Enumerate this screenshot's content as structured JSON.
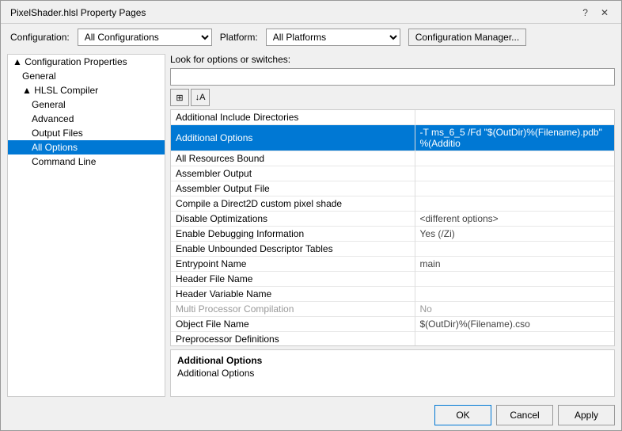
{
  "titleBar": {
    "title": "PixelShader.hlsl Property Pages",
    "helpBtn": "?",
    "closeBtn": "✕"
  },
  "config": {
    "configLabel": "Configuration:",
    "configValue": "All Configurations",
    "platformLabel": "Platform:",
    "platformValue": "All Platforms",
    "managerLabel": "Configuration Manager..."
  },
  "rightPanel": {
    "searchLabel": "Look for options or switches:",
    "searchPlaceholder": "",
    "toolbarBtn1": "≡",
    "toolbarBtn2": "↓"
  },
  "tableRows": [
    {
      "name": "Additional Include Directories",
      "value": ""
    },
    {
      "name": "Additional Options",
      "value": "-T ms_6_5 /Fd \"$(OutDir)%(Filename).pdb\" %(Additio",
      "selected": true
    },
    {
      "name": "All Resources Bound",
      "value": ""
    },
    {
      "name": "Assembler Output",
      "value": ""
    },
    {
      "name": "Assembler Output File",
      "value": ""
    },
    {
      "name": "Compile a Direct2D custom pixel shade",
      "value": ""
    },
    {
      "name": "Disable Optimizations",
      "value": "<different options>"
    },
    {
      "name": "Enable Debugging Information",
      "value": "Yes (/Zi)"
    },
    {
      "name": "Enable Unbounded Descriptor Tables",
      "value": ""
    },
    {
      "name": "Entrypoint Name",
      "value": "main"
    },
    {
      "name": "Header File Name",
      "value": ""
    },
    {
      "name": "Header Variable Name",
      "value": ""
    },
    {
      "name": "Multi Processor Compilation",
      "value": "No",
      "disabled": true
    },
    {
      "name": "Object File Name",
      "value": "$(OutDir)%(Filename).cso"
    },
    {
      "name": "Preprocessor Definitions",
      "value": ""
    }
  ],
  "description": {
    "title": "Additional Options",
    "text": "Additional Options"
  },
  "buttons": {
    "ok": "OK",
    "cancel": "Cancel",
    "apply": "Apply"
  },
  "sidebar": {
    "items": [
      {
        "label": "Configuration Properties",
        "level": 0,
        "arrow": "▲",
        "id": "config-props"
      },
      {
        "label": "General",
        "level": 1,
        "arrow": "",
        "id": "general"
      },
      {
        "label": "HLSL Compiler",
        "level": 1,
        "arrow": "▲",
        "id": "hlsl-compiler"
      },
      {
        "label": "General",
        "level": 2,
        "arrow": "",
        "id": "hlsl-general"
      },
      {
        "label": "Advanced",
        "level": 2,
        "arrow": "",
        "id": "advanced"
      },
      {
        "label": "Output Files",
        "level": 2,
        "arrow": "",
        "id": "output-files"
      },
      {
        "label": "All Options",
        "level": 2,
        "arrow": "",
        "id": "all-options",
        "selected": true
      },
      {
        "label": "Command Line",
        "level": 2,
        "arrow": "",
        "id": "command-line"
      }
    ]
  }
}
